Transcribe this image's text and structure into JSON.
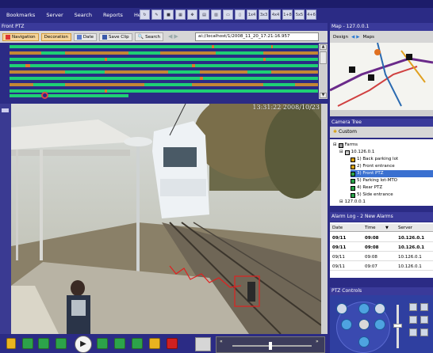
{
  "menu": [
    {
      "label": "Bookmarks"
    },
    {
      "label": "Server"
    },
    {
      "label": "Search"
    },
    {
      "label": "Reports"
    },
    {
      "label": "Help"
    }
  ],
  "toolbar_icons": [
    "",
    "",
    "",
    "",
    "",
    "",
    "",
    "",
    "",
    "1x4",
    "3x3",
    "4x4",
    "1+8",
    "5x5",
    "4+6"
  ],
  "main_panel": {
    "title": "Front PTZ",
    "buttons": {
      "navigation": "Navigation",
      "decoration": "Decoration",
      "date": "Date",
      "save_clip": "Save Clip",
      "search": "Search"
    },
    "url": "ai://localhost/1/2008_11_20_17:21:16.957",
    "timestamp": "13:31:22 2008/10/23"
  },
  "map_panel": {
    "title": "Map - 127.0.0.1",
    "design": "Design",
    "maps": "Maps"
  },
  "camera_tree": {
    "title": "Camera Tree",
    "custom": "Custom",
    "root": "Farms",
    "server": "10.126.0.1",
    "cameras": [
      "1) Back parking lot",
      "2) Front entrance",
      "3) Front PTZ",
      "5) Parking lot-MTO",
      "4) Rear PTZ",
      "5) Side entrance"
    ],
    "next_server": "127.0.0.1"
  },
  "alarm_log": {
    "title": "Alarm Log - 2 New Alarms",
    "headers": [
      "Date",
      "Time",
      "Server"
    ],
    "rows": [
      {
        "date": "09/11",
        "time": "09:08",
        "server": "10.126.0.1"
      },
      {
        "date": "09/11",
        "time": "09:08",
        "server": "10.126.0.1"
      },
      {
        "date": "09/11",
        "time": "09:08",
        "server": "10.126.0.1"
      },
      {
        "date": "09/11",
        "time": "09:07",
        "server": "10.126.0.1"
      }
    ]
  },
  "ptz": {
    "title": "PTZ Controls"
  },
  "colors": {
    "background": "#2b2b85",
    "timeline_green": "#1fcf75",
    "timeline_orange": "#e07a2a",
    "selected": "#3a70d0"
  }
}
